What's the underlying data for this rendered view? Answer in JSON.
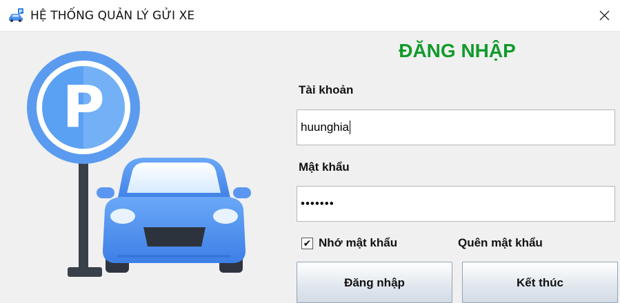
{
  "window": {
    "title": "HỆ THỐNG QUẢN LÝ GỬI XE",
    "icon": "parking-car-icon",
    "close_icon": "close-icon"
  },
  "login": {
    "heading": "ĐĂNG NHẬP",
    "username_label": "Tài khoản",
    "username_value": "huunghia",
    "password_label": "Mật khẩu",
    "password_value": "•••••••",
    "remember_label": "Nhớ mật khẩu",
    "remember_checked": true,
    "remember_mark": "✔",
    "forgot_label": "Quên mật khẩu",
    "login_button": "Đăng nhập",
    "exit_button": "Kết thúc"
  },
  "illustration": {
    "sign_letter": "P",
    "icon": "parking-sign-car-icon"
  },
  "colors": {
    "heading": "#109b2c",
    "sign_blue": "#4a8ff0",
    "car_blue": "#4f8ff0"
  }
}
